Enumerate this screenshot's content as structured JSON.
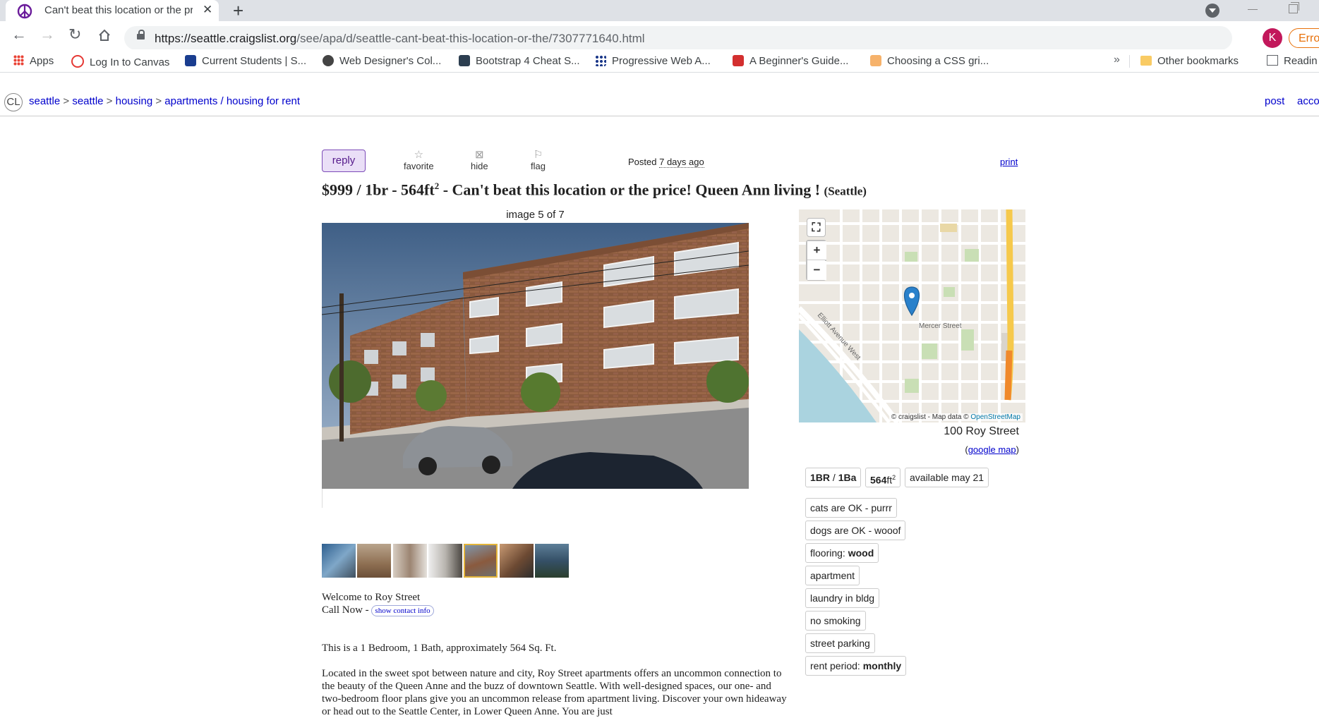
{
  "browser": {
    "tab_title": "Can't beat this location or the pri",
    "url_host": "https://seattle.craigslist.org",
    "url_path": "/see/apa/d/seattle-cant-beat-this-location-or-the/7307771640.html",
    "profile_initial": "K",
    "error_label": "Error",
    "bookmarks": [
      {
        "label": "Apps"
      },
      {
        "label": "Log In to Canvas"
      },
      {
        "label": "Current Students | S..."
      },
      {
        "label": "Web Designer's Col..."
      },
      {
        "label": "Bootstrap 4 Cheat S..."
      },
      {
        "label": "Progressive Web A..."
      },
      {
        "label": "A Beginner's Guide..."
      },
      {
        "label": "Choosing a CSS gri..."
      }
    ],
    "other_bookmarks": "Other bookmarks",
    "reading_list": "Readin"
  },
  "header": {
    "logo": "CL",
    "crumbs": [
      "seattle",
      "seattle",
      "housing",
      "apartments / housing for rent"
    ],
    "post": "post",
    "account": "acco"
  },
  "posting": {
    "reply_label": "reply",
    "favorite_label": "favorite",
    "hide_label": "hide",
    "flag_label": "flag",
    "posted_prefix": "Posted",
    "posted_time": "7 days ago",
    "print_label": "print",
    "title_price": "$999",
    "title_housing_a": "/ 1br - 564ft",
    "title_housing_sup": "2",
    "title_text": "- Can't beat this location or the price! Queen Ann living !",
    "title_hood": "(Seattle)"
  },
  "gallery": {
    "counter": "image 5 of 7",
    "thumb_count": 7,
    "active_index": 4
  },
  "map": {
    "street_label": "Mercer Street",
    "avenue_label": "Elliott Avenue West",
    "attribution_prefix": "© craigslist - Map data ©",
    "attribution_link": "OpenStreetMap",
    "address": "100 Roy Street",
    "google_map_label": "google map"
  },
  "attributes": {
    "bedrooms": "1BR",
    "bathrooms": "1Ba",
    "sqft": "564",
    "sqft_unit": "ft",
    "sqft_sup": "2",
    "available": "available may 21",
    "cats": "cats are OK - purrr",
    "dogs": "dogs are OK - wooof",
    "flooring_label": "flooring:",
    "flooring_value": "wood",
    "housing_type": "apartment",
    "laundry": "laundry in bldg",
    "smoking": "no smoking",
    "parking": "street parking",
    "rent_period_label": "rent period:",
    "rent_period_value": "monthly"
  },
  "body": {
    "line1": "Welcome to Roy Street",
    "line2_prefix": "Call Now -",
    "contact_button": "show contact info",
    "para1": "This is a 1 Bedroom, 1 Bath, approximately 564 Sq. Ft.",
    "para2": "Located in the sweet spot between nature and city, Roy Street apartments offers an uncommon connection to the beauty of the Queen Anne and the buzz of downtown Seattle. With well-designed spaces, our one- and two-bedroom floor plans give you an uncommon release from apartment living. Discover your own hideaway or head out to the Seattle Center, in Lower Queen Anne. You are just"
  },
  "colors": {
    "link": "#0000cc",
    "reply_bg": "#eadff7",
    "active_thumb": "#e3b43a",
    "map_pin": "#2a81cb"
  }
}
